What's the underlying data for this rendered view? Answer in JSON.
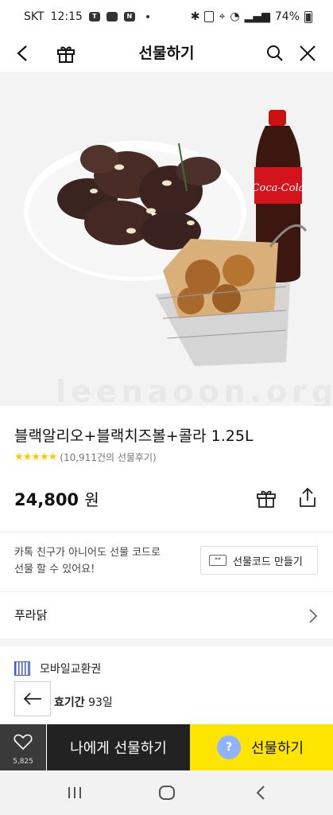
{
  "status_bar": {
    "carrier": "SKT",
    "time": "12:15",
    "battery": "74%"
  },
  "header": {
    "title": "선물하기"
  },
  "product": {
    "watermark": "leenaoon.org",
    "title": "블랙알리오+블랙치즈볼+콜라 1.25L",
    "rating_stars": "★★★★★",
    "review_text": "(10,911건의 선물후기)",
    "price": "24,800",
    "currency": "원"
  },
  "gift_code": {
    "line1": "카톡 친구가 아니어도 선물 코드로",
    "line2": "선물 할 수 있어요!",
    "button_label": "선물코드 만들기",
    "icon_text": "**"
  },
  "brand": {
    "name": "푸라닭"
  },
  "voucher": {
    "type": "모바일교환권",
    "validity_label": "효기간",
    "validity_value": "93일"
  },
  "action_bar": {
    "wish_count": "5,825",
    "gift_to_me_label": "나에게 선물하기",
    "gift_label": "선물하기",
    "help_glyph": "?"
  },
  "colors": {
    "kakao_yellow": "#fee500",
    "dark": "#222222",
    "star": "#ffc800",
    "voucher_blue": "#3b5bdb"
  }
}
